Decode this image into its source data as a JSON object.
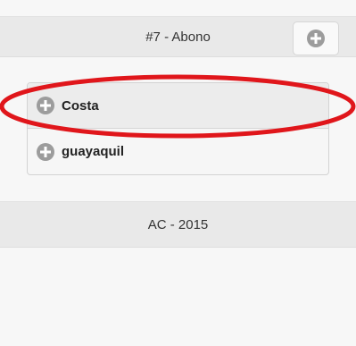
{
  "sections": [
    {
      "title": "#7 - Abono",
      "add_icon": "plus-circle-icon",
      "items": [
        {
          "label": "Costa",
          "icon": "plus-circle-icon"
        },
        {
          "label": "guayaquil",
          "icon": "plus-circle-icon"
        }
      ]
    },
    {
      "title": "AC - 2015"
    }
  ],
  "highlight": {
    "shape": "ellipse",
    "color": "#e0161b",
    "target": "Costa"
  }
}
